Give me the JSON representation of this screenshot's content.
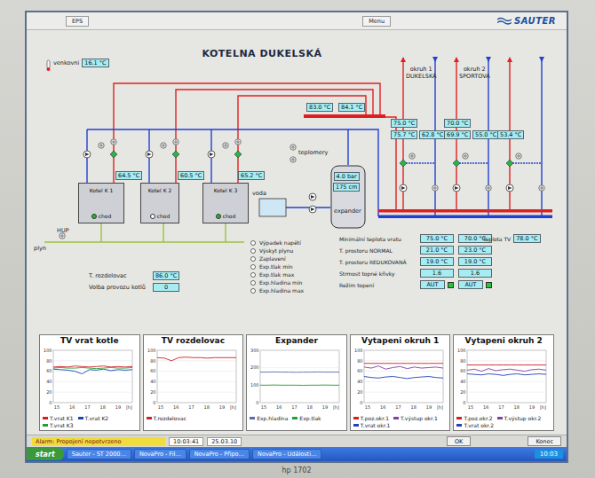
{
  "window": {
    "buttons": [
      "EPS",
      "Menu"
    ],
    "logo": "SAUTER"
  },
  "title": "KOTELNA DUKELSKÁ",
  "outdoor": {
    "label": "venkovni",
    "value": "16.1 °C"
  },
  "header_values": [
    "83.0 °C",
    "84.1 °C"
  ],
  "circuits": [
    {
      "label": "okruh 1",
      "name": "DUKELSKÁ",
      "values": [
        "75.0 °C",
        "75.7 °C",
        "62.8 °C"
      ]
    },
    {
      "label": "okruh 2",
      "name": "SPORTOVA",
      "values": [
        "70.0 °C",
        "69.9 °C",
        "55.0 °C"
      ]
    },
    {
      "values": [
        "53.4 °C"
      ]
    }
  ],
  "boilers": [
    {
      "name": "Kotel K 1",
      "status": "chod",
      "running": true,
      "temp": "64.5 °C"
    },
    {
      "name": "Kotel K 2",
      "status": "chod",
      "running": false,
      "temp": "60.5 °C"
    },
    {
      "name": "Kotel K 3",
      "status": "chod",
      "running": true,
      "temp": "65.2 °C"
    }
  ],
  "labels": {
    "gas_meter": "HUP",
    "gas": "plyn",
    "water": "voda",
    "thermometers": "teplomery"
  },
  "expander": {
    "name": "expander",
    "pressure": "4.0 bar",
    "level_reading": "175 cm"
  },
  "params": [
    {
      "label": "T. rozdelovac",
      "value": "86.0 °C"
    },
    {
      "label": "Volba provozu kotlů",
      "value": "0"
    }
  ],
  "alarms": [
    {
      "label": "Výpadek napětí",
      "active": false
    },
    {
      "label": "Výskyt plynu",
      "active": false
    },
    {
      "label": "Zaplavení",
      "active": false
    },
    {
      "label": "Exp.tlak min",
      "active": false
    },
    {
      "label": "Exp.tlak max",
      "active": false
    },
    {
      "label": "Exp.hladina min",
      "active": false
    },
    {
      "label": "Exp.hladina max",
      "active": false
    }
  ],
  "setpoints": {
    "rows": [
      {
        "label": "Minimální teplota vratu",
        "kind": "value",
        "values": [
          "75.0 °C",
          "70.0 °C"
        ]
      },
      {
        "label": "T. prostoru NORMAL",
        "kind": "value",
        "values": [
          "21.0 °C",
          "23.0 °C"
        ]
      },
      {
        "label": "T. prostoru REDUKOVANÁ",
        "kind": "value",
        "values": [
          "19.0 °C",
          "19.0 °C"
        ]
      },
      {
        "label": "Strmost topné křivky",
        "kind": "value",
        "values": [
          "1.6",
          "1.6"
        ]
      },
      {
        "label": "Režim topení",
        "kind": "mode",
        "values": [
          "AUT",
          "AUT"
        ],
        "on": [
          true,
          true
        ]
      }
    ],
    "tv": {
      "label": "Teplota TV",
      "value": "78.0 °C"
    }
  },
  "charts": [
    {
      "title": "TV vrat kotle",
      "y_ticks": [
        "100",
        "80",
        "60",
        "40",
        "20",
        "0"
      ],
      "x_ticks": [
        "15",
        "16",
        "17",
        "18",
        "19"
      ],
      "unit": "[h]",
      "series": [
        {
          "name": "T.vrat K1",
          "color": "#d02020",
          "values": [
            68,
            69,
            68,
            70,
            69,
            68,
            69,
            70,
            68,
            69,
            68,
            69
          ]
        },
        {
          "name": "T.vrat K2",
          "color": "#2040c0",
          "values": [
            64,
            63,
            62,
            60,
            55,
            63,
            62,
            64,
            61,
            63,
            62,
            63
          ]
        },
        {
          "name": "T.vrat K3",
          "color": "#20a030",
          "values": [
            66,
            67,
            66,
            66,
            67,
            66,
            65,
            66,
            67,
            66,
            66,
            67
          ]
        }
      ]
    },
    {
      "title": "TV rozdelovac",
      "y_ticks": [
        "100",
        "80",
        "60",
        "40",
        "20",
        "0"
      ],
      "x_ticks": [
        "15",
        "16",
        "17",
        "18",
        "19"
      ],
      "unit": "[h]",
      "series": [
        {
          "name": "T.rozdelovac",
          "color": "#d02020",
          "values": [
            86,
            85,
            80,
            86,
            87,
            86,
            86,
            85,
            86,
            86,
            86,
            86
          ]
        }
      ]
    },
    {
      "title": "Expander",
      "y_ticks": [
        "300",
        "200",
        "100",
        "0"
      ],
      "x_ticks": [
        "15",
        "16",
        "17",
        "18",
        "19"
      ],
      "unit": "[h]",
      "series": [
        {
          "name": "Exp.hladina",
          "color": "#5a6ab0",
          "values": [
            175,
            175,
            176,
            175,
            175,
            174,
            175,
            175,
            176,
            175,
            175,
            175
          ]
        },
        {
          "name": "Exp.tlak",
          "color": "#20a030",
          "values": [
            100,
            100,
            101,
            100,
            100,
            100,
            99,
            100,
            100,
            101,
            100,
            100
          ]
        }
      ]
    },
    {
      "title": "Vytapeni okruh 1",
      "y_ticks": [
        "100",
        "80",
        "60",
        "40",
        "20",
        "0"
      ],
      "x_ticks": [
        "15",
        "16",
        "17",
        "18",
        "19"
      ],
      "unit": "[h]",
      "series": [
        {
          "name": "T.poz.okr.1",
          "color": "#d02020",
          "values": [
            75,
            75,
            75,
            75,
            75,
            75,
            75,
            75,
            75,
            75,
            75,
            75
          ]
        },
        {
          "name": "T.výstup okr.1",
          "color": "#8040a0",
          "values": [
            68,
            66,
            70,
            64,
            67,
            69,
            65,
            68,
            66,
            67,
            68,
            66
          ]
        },
        {
          "name": "T.vrat okr.1",
          "color": "#2040c0",
          "values": [
            50,
            48,
            47,
            49,
            50,
            48,
            46,
            48,
            49,
            50,
            48,
            47
          ]
        }
      ]
    },
    {
      "title": "Vytapeni okruh 2",
      "y_ticks": [
        "100",
        "80",
        "60",
        "40",
        "20",
        "0"
      ],
      "x_ticks": [
        "15",
        "16",
        "17",
        "18",
        "19"
      ],
      "unit": "[h]",
      "series": [
        {
          "name": "T.poz.okr.2",
          "color": "#d02020",
          "values": [
            72,
            72,
            72,
            72,
            72,
            72,
            72,
            72,
            72,
            72,
            72,
            72
          ]
        },
        {
          "name": "T.výstup okr.2",
          "color": "#8040a0",
          "values": [
            62,
            64,
            60,
            65,
            61,
            63,
            64,
            62,
            60,
            63,
            64,
            62
          ]
        },
        {
          "name": "T.vrat okr.2",
          "color": "#2040c0",
          "values": [
            55,
            54,
            53,
            55,
            54,
            52,
            54,
            55,
            53,
            54,
            55,
            54
          ]
        }
      ]
    }
  ],
  "status_bar": {
    "alarm": "Alarm: Propojení nepotvrzeno",
    "time": "10:03:41",
    "date": "25.03.10",
    "buttons": [
      "OK",
      "Konec"
    ]
  },
  "taskbar": {
    "start": "start",
    "items": [
      "Sauter - ST 2000…",
      "NovaPro - Fil…",
      "NovaPro - Připo…",
      "NovaPro - Události…"
    ],
    "clock": "10:03"
  },
  "monitor": {
    "model": "hp 1702"
  }
}
